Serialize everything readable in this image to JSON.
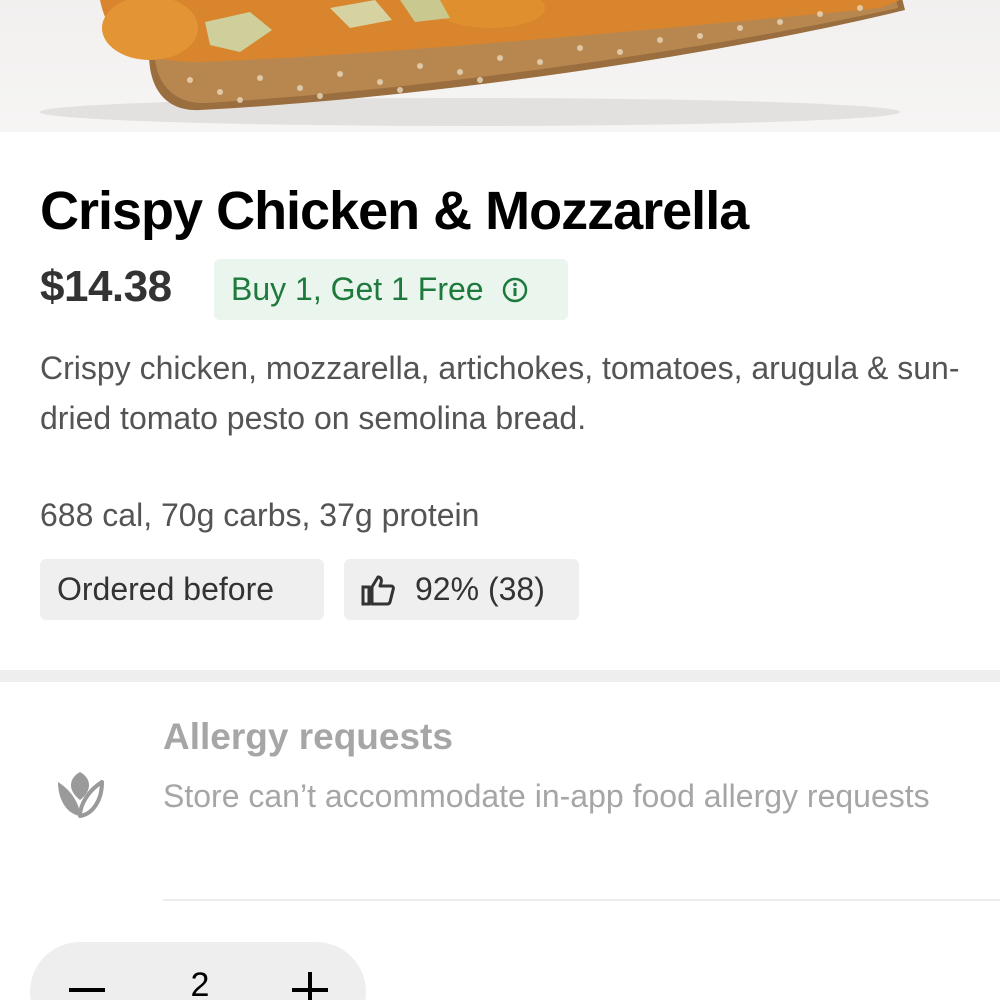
{
  "item": {
    "title": "Crispy Chicken & Mozzarella",
    "price": "$14.38",
    "promo_label": "Buy 1, Get 1 Free",
    "description": "Crispy chicken, mozzarella, artichokes, tomatoes, arugula & sun-dried tomato pesto on semolina bread.",
    "nutrition": "688 cal, 70g carbs, 37g protein"
  },
  "tags": {
    "ordered_before": "Ordered before",
    "rating": "92% (38)"
  },
  "allergy": {
    "title": "Allergy requests",
    "description": "Store can’t accommodate in-app food allergy requests"
  },
  "quantity": {
    "value": "2"
  },
  "colors": {
    "promo_bg": "#e9f5ed",
    "promo_text": "#1e7a3c",
    "chip_bg": "#efefef",
    "muted_text": "#a6a6a6"
  },
  "icons": {
    "promo_info": "info-icon",
    "rating": "thumbs-up-icon",
    "allergy": "leaf-icon",
    "decrease": "minus-icon",
    "increase": "plus-icon"
  }
}
